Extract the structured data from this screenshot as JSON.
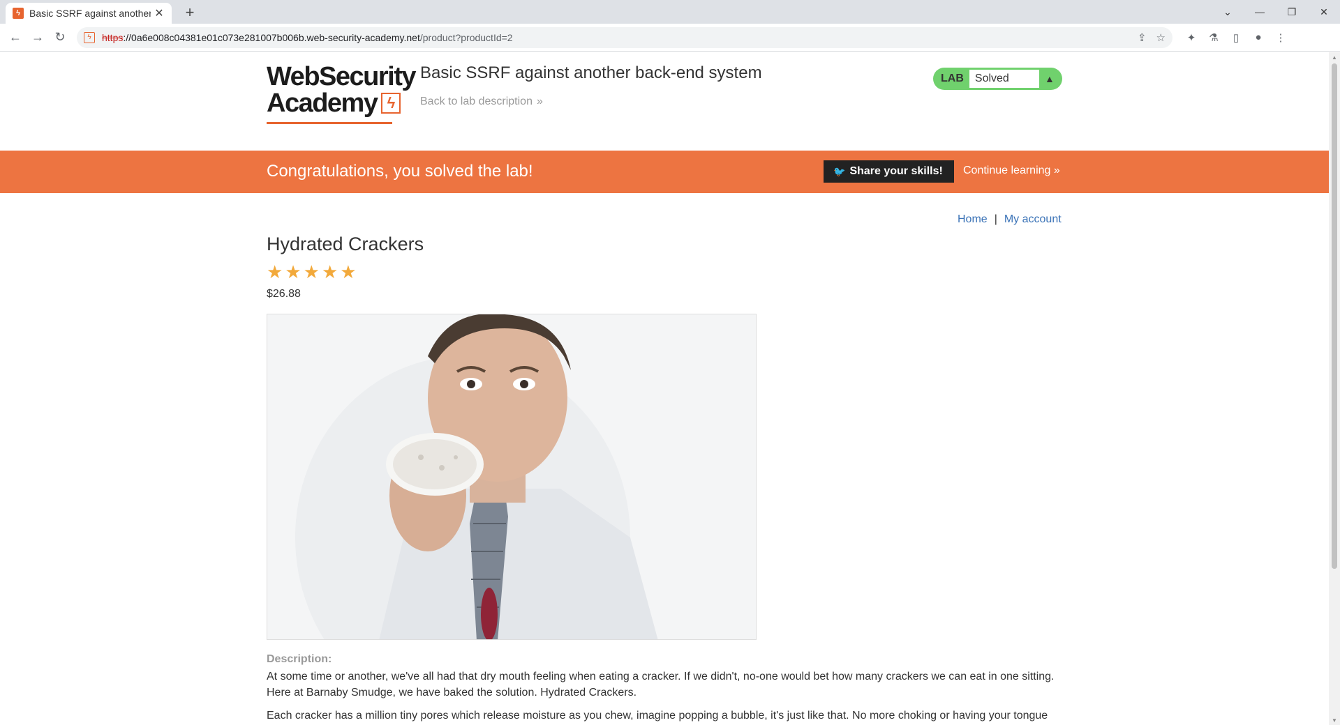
{
  "browser": {
    "tab_title": "Basic SSRF against another",
    "favicon_letter": "ϟ",
    "url_scheme": "https",
    "url_host": "://0a6e008c04381e01c073e281007b006b.web-security-academy.net",
    "url_path": "/product?productId=2"
  },
  "header": {
    "logo_line1": "WebSecurity",
    "logo_line2": "Academy",
    "logo_bolt": "ϟ",
    "lab_title": "Basic SSRF against another back-end system",
    "back_link": "Back to lab description",
    "back_chevron": "»",
    "lab_tag": "LAB",
    "lab_state": "Solved"
  },
  "banner": {
    "message": "Congratulations, you solved the lab!",
    "share_label": "Share your skills!",
    "continue_label": "Continue learning",
    "continue_chevron": "»"
  },
  "nav": {
    "home": "Home",
    "separator": "|",
    "account": "My account"
  },
  "product": {
    "name": "Hydrated Crackers",
    "rating_stars": 5,
    "price": "$26.88",
    "description_label": "Description:",
    "description_p1": "At some time or another, we've all had that dry mouth feeling when eating a cracker. If we didn't, no-one would bet how many crackers we can eat in one sitting. Here at Barnaby Smudge, we have baked the solution. Hydrated Crackers.",
    "description_p2": "Each cracker has a million tiny pores which release moisture as you chew, imagine popping a bubble, it's just like that. No more choking or having your tongue"
  },
  "colors": {
    "accent": "#ed7441",
    "lab_solved": "#70d16d",
    "link": "#3b73b7",
    "star": "#f2a93b"
  }
}
